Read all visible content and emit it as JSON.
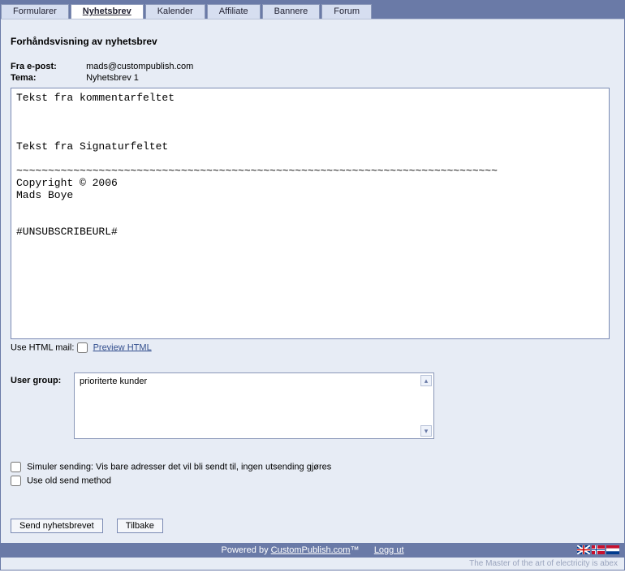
{
  "tabs": [
    {
      "label": "Formularer",
      "active": false
    },
    {
      "label": "Nyhetsbrev",
      "active": true
    },
    {
      "label": "Kalender",
      "active": false
    },
    {
      "label": "Affiliate",
      "active": false
    },
    {
      "label": "Bannere",
      "active": false
    },
    {
      "label": "Forum",
      "active": false
    }
  ],
  "title": "Forhåndsvisning av nyhetsbrev",
  "meta": {
    "from_label": "Fra e-post:",
    "from_value": "mads@custompublish.com",
    "subject_label": "Tema:",
    "subject_value": "Nyhetsbrev 1"
  },
  "body_text": "Tekst fra kommentarfeltet\n\n\n\nTekst fra Signaturfeltet\n\n~~~~~~~~~~~~~~~~~~~~~~~~~~~~~~~~~~~~~~~~~~~~~~~~~~~~~~~~~~~~~~~~~~~~~~~~~~~~\nCopyright © 2006\nMads Boye\n\n\n#UNSUBSCRIBEURL#",
  "html_mail": {
    "label": "Use HTML mail:",
    "preview_link": "Preview HTML"
  },
  "usergroup": {
    "label": "User group:",
    "value": "prioriterte kunder"
  },
  "checks": {
    "simulate": "Simuler sending: Vis bare adresser det vil bli sendt til, ingen utsending gjøres",
    "oldmethod": "Use old send method"
  },
  "buttons": {
    "send": "Send nyhetsbrevet",
    "back": "Tilbake"
  },
  "footer": {
    "powered_prefix": "Powered by ",
    "powered_link": "CustomPublish.com",
    "powered_suffix": "™",
    "logout": "Logg ut",
    "tagline": "The Master of the art of electricity is abex"
  },
  "flags": [
    "uk",
    "no",
    "nl"
  ]
}
